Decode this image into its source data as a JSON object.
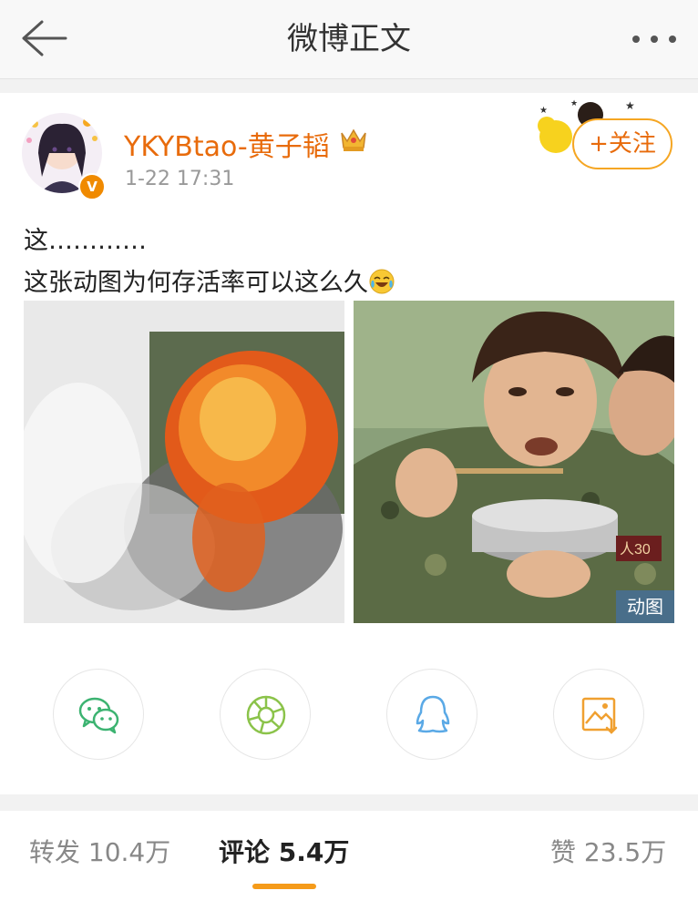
{
  "nav": {
    "back_icon": "arrow-left-icon",
    "title": "微博正文",
    "more_icon": "more-dots-icon"
  },
  "post": {
    "author": {
      "name": "YKYBtao-黄子韬",
      "verified_badge": "V",
      "vip_icon": "crown-icon",
      "avatar_icon": "avatar"
    },
    "time": "1-22 17:31",
    "follow_label": "+关注",
    "text_line1": "这…………",
    "text_line2": "这张动图为何存活率可以这么久",
    "emoji": "laugh-cry-emoji",
    "images": [
      {
        "description_icon": "explosion-image"
      },
      {
        "description_icon": "boy-eating-image",
        "badge": "动图"
      }
    ]
  },
  "share": {
    "items": [
      "wechat-icon",
      "moments-icon",
      "qq-icon",
      "save-image-icon"
    ]
  },
  "tabs": {
    "repost": "转发 10.4万",
    "comment": "评论 5.4万",
    "like": "赞 23.5万",
    "active": "comment"
  },
  "colors": {
    "accent": "#e86b0b",
    "tab_underline": "#f59b1a",
    "wechat": "#3cb371",
    "moments": "#8bc34a",
    "qq": "#5aa9e6",
    "save": "#f0a030"
  }
}
